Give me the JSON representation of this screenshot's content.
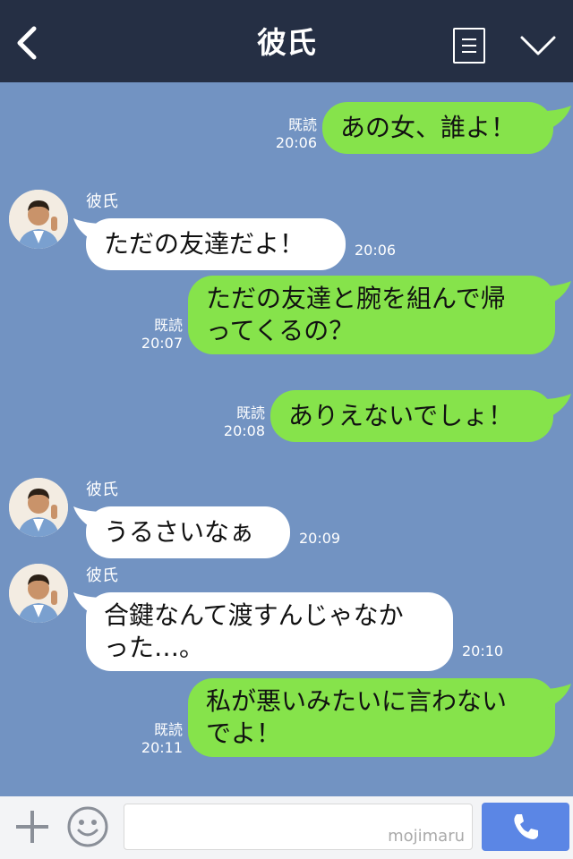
{
  "header": {
    "title": "彼氏"
  },
  "messages": [
    {
      "from": "me",
      "text": "あの女、誰よ！",
      "read": "既読",
      "time": "20:06"
    },
    {
      "from": "them",
      "sender": "彼氏",
      "text": "ただの友達だよ！",
      "time": "20:06"
    },
    {
      "from": "me",
      "text_lines": [
        "ただの友達と腕を組んで帰",
        "ってくるの？"
      ],
      "read": "既読",
      "time": "20:07"
    },
    {
      "from": "me",
      "text": "ありえないでしょ！",
      "read": "既読",
      "time": "20:08"
    },
    {
      "from": "them",
      "sender": "彼氏",
      "text": "うるさいなぁ",
      "time": "20:09"
    },
    {
      "from": "them",
      "sender": "彼氏",
      "text_lines": [
        "合鍵なんて渡すんじゃなか",
        "った…。"
      ],
      "time": "20:10"
    },
    {
      "from": "me",
      "text_lines": [
        "私が悪いみたいに言わない",
        "でよ！"
      ],
      "read": "既読",
      "time": "20:11"
    }
  ],
  "footer": {
    "input_value": "",
    "watermark": "mojimaru"
  },
  "colors": {
    "header_bg": "#252f44",
    "chat_bg": "#7293c2",
    "my_bubble": "#86e34b",
    "their_bubble": "#ffffff",
    "call_button": "#5b86e5"
  },
  "icons": [
    "back-arrow-icon",
    "menu-list-icon",
    "chevron-down-icon",
    "plus-icon",
    "emoji-icon",
    "phone-icon"
  ]
}
